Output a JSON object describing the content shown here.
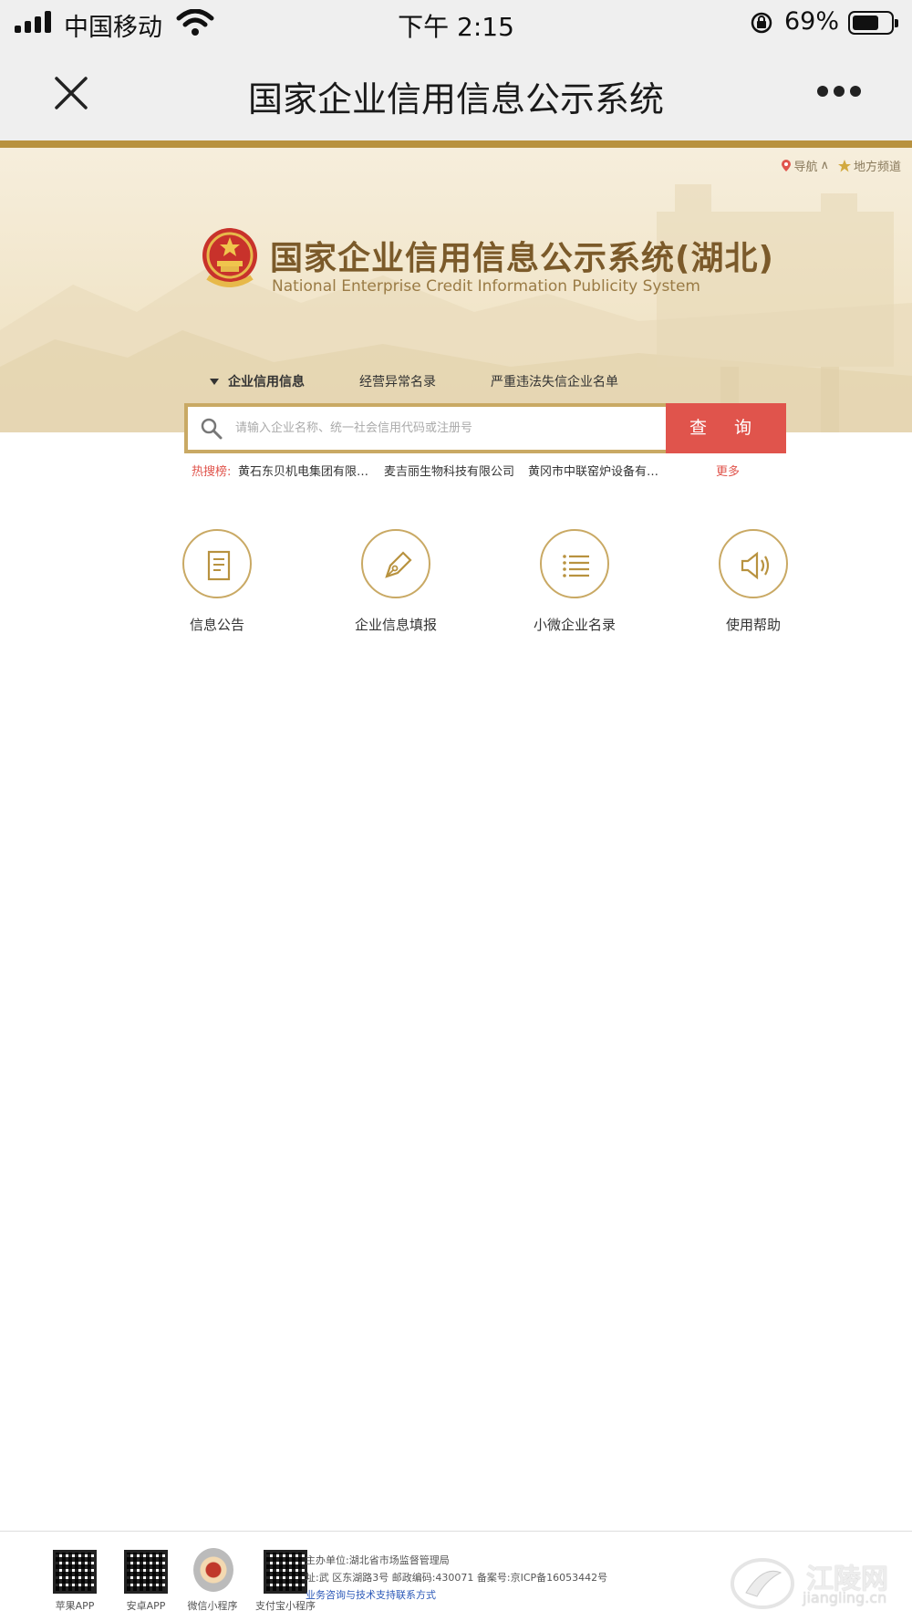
{
  "status_bar": {
    "carrier": "中国移动",
    "time": "下午 2:15",
    "battery": "69%",
    "battery_level": 0.69
  },
  "nav": {
    "title": "国家企业信用信息公示系统"
  },
  "hero": {
    "top_links": [
      {
        "label": "导航"
      },
      {
        "label": "地方频道"
      }
    ],
    "title": "国家企业信用信息公示系统(湖北)",
    "subtitle": "National Enterprise Credit Information Publicity System",
    "tabs": [
      {
        "label": "企业信用信息"
      },
      {
        "label": "经营异常名录"
      },
      {
        "label": "严重违法失信企业名单"
      }
    ]
  },
  "search": {
    "placeholder": "请输入企业名称、统一社会信用代码或注册号",
    "button_label": "查 询"
  },
  "hot": {
    "label": "热搜榜:",
    "items": [
      "黄石东贝机电集团有限…",
      "麦吉丽生物科技有限公司",
      "黄冈市中联窑炉设备有…"
    ],
    "more": "更多"
  },
  "features": [
    {
      "label": "信息公告",
      "icon": "document-icon"
    },
    {
      "label": "企业信息填报",
      "icon": "pen-icon"
    },
    {
      "label": "小微企业名录",
      "icon": "list-icon"
    },
    {
      "label": "使用帮助",
      "icon": "speaker-icon"
    }
  ],
  "footer": {
    "qr_labels": [
      "苹果APP",
      "安卓APP",
      "微信小程序",
      "支付宝小程序"
    ],
    "info_lines": [
      "主办单位:湖北省市场监督管理局",
      "址:武    区东湖路3号   邮政编码:430071   备案号:京ICP备16053442号"
    ],
    "link": "业务咨询与技术支持联系方式"
  },
  "watermark": {
    "text": "江陵网",
    "url": "jiangling.cn"
  },
  "colors": {
    "accent_gold": "#b8923f",
    "search_button": "#e0544c",
    "hot_label": "#e0544c"
  }
}
